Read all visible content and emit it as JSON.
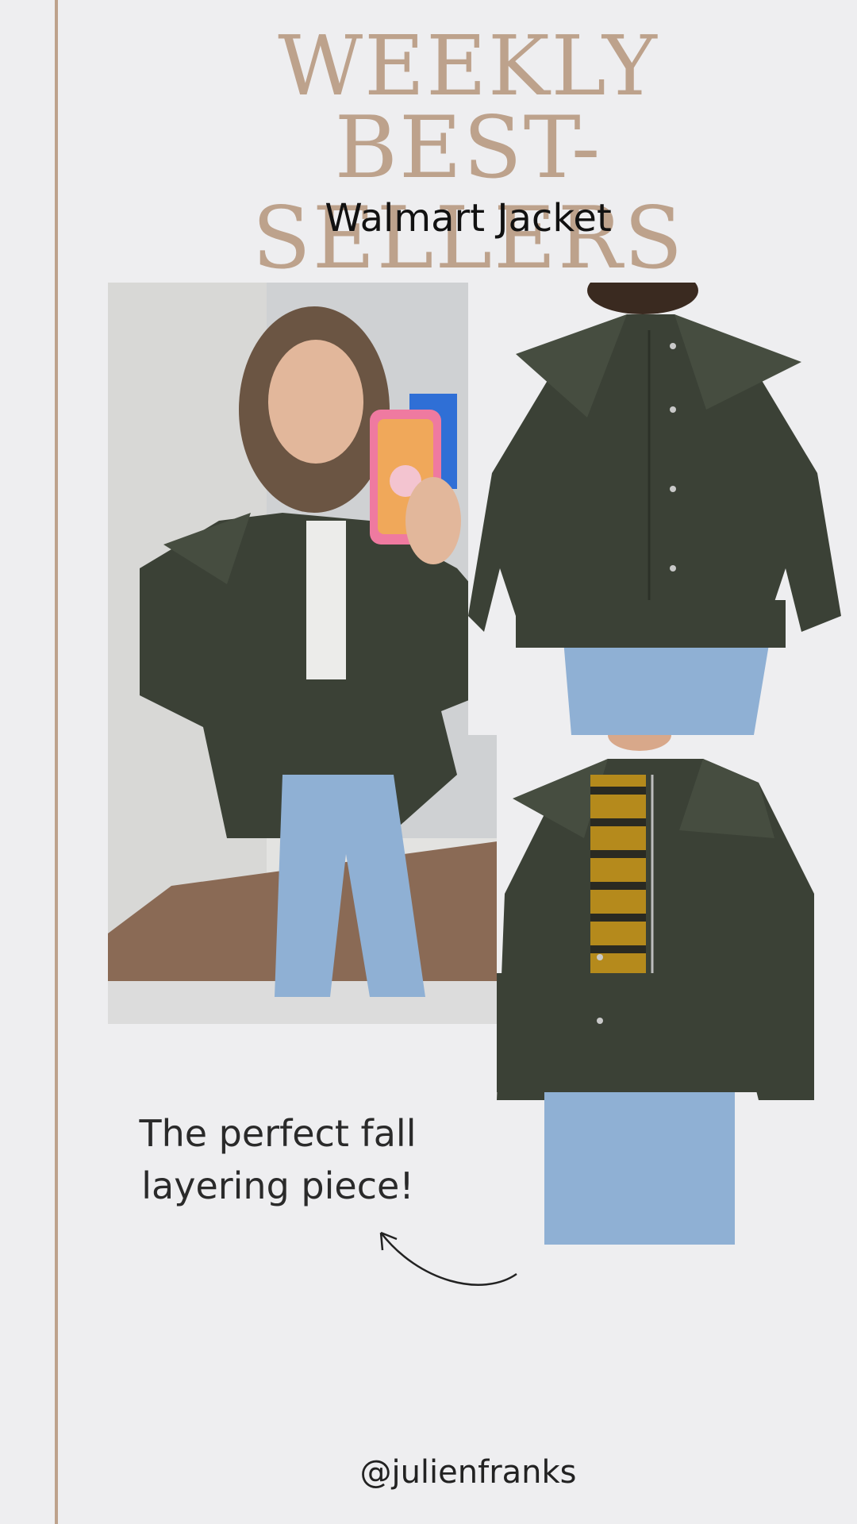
{
  "header": {
    "title_line1": "WEEKLY",
    "title_line2": "BEST-SELLERS",
    "subtitle": "Walmart Jacket"
  },
  "caption": {
    "line1": "The perfect fall",
    "line2": "layering piece!"
  },
  "footer": {
    "handle": "@julienfranks"
  },
  "colors": {
    "accent": "#bda28c",
    "background": "#eeeef0",
    "jacket": "#3b4136",
    "denim": "#8fb0d4"
  },
  "icons": {
    "arrow": "curved-arrow-icon"
  }
}
